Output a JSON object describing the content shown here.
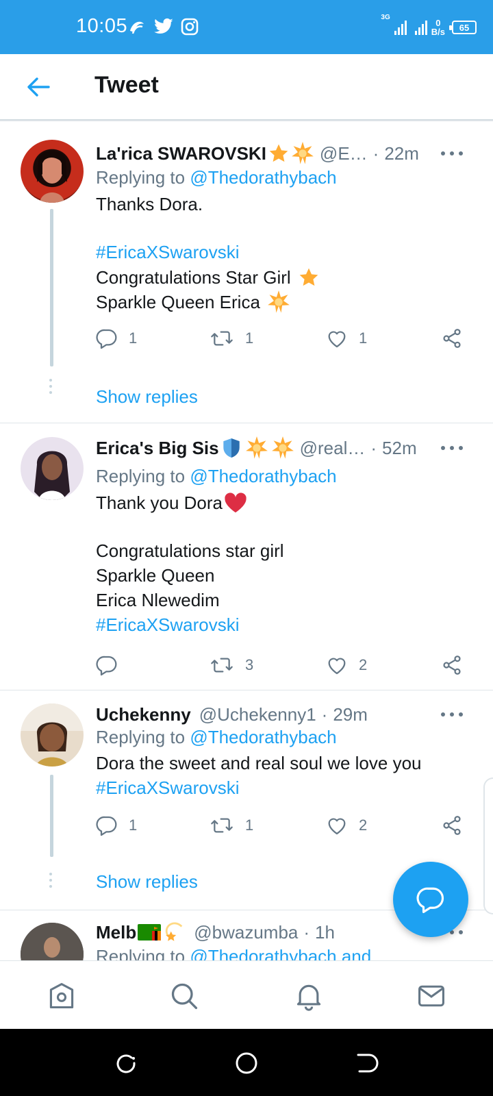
{
  "status_bar": {
    "time": "10:05",
    "net_speed_value": "0",
    "net_speed_unit": "B/s",
    "battery": "65",
    "network_type": "3G"
  },
  "header": {
    "title": "Tweet"
  },
  "tweets": [
    {
      "name": "La'rica SWAROVSKI",
      "handle": "@E…",
      "time": "22m",
      "replying_prefix": "Replying to ",
      "replying_to": "@Thedorathybach",
      "lines": [
        "Thanks Dora.",
        "#EricaXSwarovski",
        "Congratulations Star Girl",
        "Sparkle Queen Erica"
      ],
      "counts": {
        "reply": "1",
        "retweet": "1",
        "like": "1"
      },
      "show_replies": "Show replies"
    },
    {
      "name": "Erica's Big Sis",
      "handle": "@real…",
      "time": "52m",
      "replying_prefix": "Replying to ",
      "replying_to": "@Thedorathybach",
      "lines": [
        "Thank you Dora",
        "Congratulations star girl",
        "Sparkle Queen",
        "Erica Nlewedim",
        "#EricaXSwarovski"
      ],
      "counts": {
        "reply": "",
        "retweet": "3",
        "like": "2"
      }
    },
    {
      "name": "Uchekenny",
      "handle": "@Uchekenny1",
      "time": "29m",
      "replying_prefix": "Replying to ",
      "replying_to": "@Thedorathybach",
      "lines": [
        "Dora the sweet and real soul we love you",
        "#EricaXSwarovski"
      ],
      "counts": {
        "reply": "1",
        "retweet": "1",
        "like": "2"
      },
      "show_replies": "Show replies"
    },
    {
      "name": "Melb",
      "handle": "@bwazumba",
      "time": "1h",
      "replying_prefix": "Replying to ",
      "replying_to": "@Thedorathybach and"
    }
  ],
  "separator": "·",
  "colors": {
    "brand_blue": "#1da1f2",
    "status_bar": "#2a9ee8",
    "secondary_text": "#657786",
    "primary_text": "#14171a",
    "heart_red": "#e0245e",
    "star_orange": "#ffac33"
  },
  "icons": {
    "back": "arrow-left-icon",
    "reply": "speech-bubble-icon",
    "retweet": "retweet-icon",
    "like": "heart-icon",
    "share": "share-icon",
    "compose": "compose-reply-icon",
    "nav": [
      "home-icon",
      "search-icon",
      "bell-icon",
      "mail-icon"
    ]
  }
}
